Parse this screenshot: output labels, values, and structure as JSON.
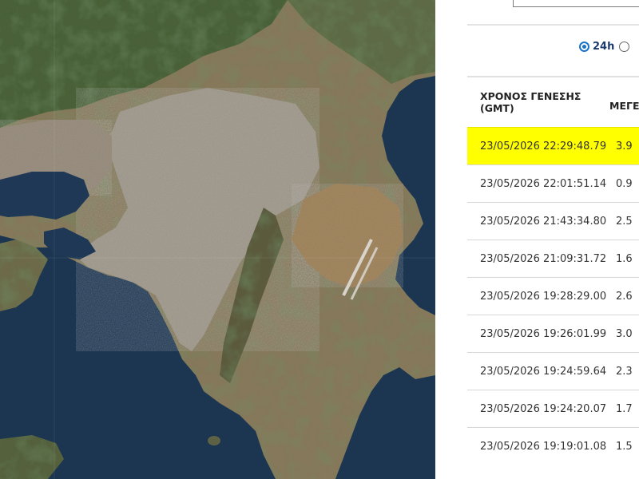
{
  "filter": {
    "options": [
      {
        "label": "24h",
        "selected": true
      },
      {
        "label": "",
        "selected": false
      }
    ]
  },
  "table": {
    "header_time": "ΧΡΟΝΟΣ ΓΕΝΕΣΗΣ (GMT)",
    "header_magnitude": "ΜΕΓΕΘ",
    "highlight_color": "#ffff00",
    "rows": [
      {
        "time": "23/05/2026 22:29:48.79",
        "magnitude": "3.9",
        "highlighted": true
      },
      {
        "time": "23/05/2026 22:01:51.14",
        "magnitude": "0.9",
        "highlighted": false
      },
      {
        "time": "23/05/2026 21:43:34.80",
        "magnitude": "2.5",
        "highlighted": false
      },
      {
        "time": "23/05/2026 21:09:31.72",
        "magnitude": "1.6",
        "highlighted": false
      },
      {
        "time": "23/05/2026 19:28:29.00",
        "magnitude": "2.6",
        "highlighted": false
      },
      {
        "time": "23/05/2026 19:26:01.99",
        "magnitude": "3.0",
        "highlighted": false
      },
      {
        "time": "23/05/2026 19:24:59.64",
        "magnitude": "2.3",
        "highlighted": false
      },
      {
        "time": "23/05/2026 19:24:20.07",
        "magnitude": "1.7",
        "highlighted": false
      },
      {
        "time": "23/05/2026 19:19:01.08",
        "magnitude": "1.5",
        "highlighted": false
      }
    ]
  },
  "map": {
    "sea_color": "#1b3550",
    "land_color": "#8a7a5e",
    "urban_color": "#a49e94",
    "forest_color": "#3e5a34"
  }
}
